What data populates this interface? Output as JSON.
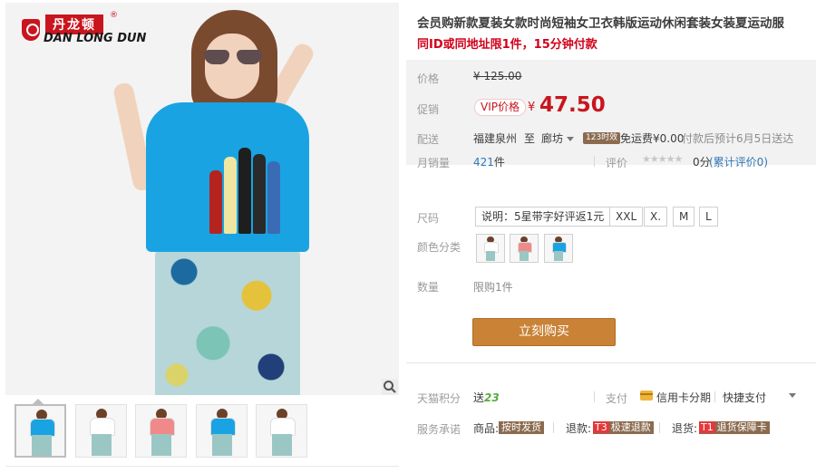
{
  "brand": {
    "cn": "丹龙顿",
    "en": "DAN LONG DUN",
    "reg": "®"
  },
  "product": {
    "title": "会员购新款夏装女款时尚短袖女卫衣韩版运动休闲套装女装夏运动服",
    "subtitle": "同ID或同地址限1件，15分钟付款"
  },
  "price": {
    "label": "价格",
    "original": "¥ 125.00",
    "promo_label": "促销",
    "vip_tag": "VIP价格",
    "currency": "¥",
    "sale": "47.50"
  },
  "shipping": {
    "label": "配送",
    "from": "福建泉州",
    "to_word": "至",
    "to": "廊坊",
    "badge": "123时效",
    "fee": "免运费¥0.00",
    "eta": "付款后预计6月5日送达"
  },
  "sales": {
    "label": "月销量",
    "count": "421",
    "unit": "件",
    "rating_label": "评价",
    "stars": "★★★★★",
    "rating_score": "0分",
    "reviews": "(累计评价0)"
  },
  "size": {
    "label": "尺码",
    "options": [
      "说明：5星带字好评返1元",
      "XXL",
      "X.",
      "M",
      "L"
    ]
  },
  "color": {
    "label": "颜色分类",
    "swatches": [
      {
        "name": "white",
        "shirt": "#ffffff"
      },
      {
        "name": "pink",
        "shirt": "#f08a8a"
      },
      {
        "name": "blue",
        "shirt": "#1aa3e2"
      }
    ]
  },
  "quantity": {
    "label": "数量",
    "limit": "限购1件"
  },
  "buy_button": "立刻购买",
  "points": {
    "label": "天猫积分",
    "prefix": "送",
    "value": "23"
  },
  "payment": {
    "label": "支付",
    "credit": "信用卡分期",
    "express": "快捷支付"
  },
  "service": {
    "label": "服务承诺",
    "items": [
      {
        "prefix": "商品:",
        "tag_red": "",
        "tag": "按时发货"
      },
      {
        "prefix": "退款:",
        "tag_red": "T3",
        "tag": "极速退款"
      },
      {
        "prefix": "退货:",
        "tag_red": "T1",
        "tag": "退货保障卡"
      }
    ]
  },
  "thumbnails": [
    {
      "shirt": "#1aa3e2",
      "active": true
    },
    {
      "shirt": "#ffffff",
      "active": false
    },
    {
      "shirt": "#f08a8a",
      "active": false
    },
    {
      "shirt": "#1aa3e2",
      "active": false
    },
    {
      "shirt": "#ffffff",
      "active": false
    }
  ],
  "colors": {
    "accent_red": "#c9151e",
    "buy_button": "#c98236",
    "tag_brown": "#8b6b4f"
  }
}
